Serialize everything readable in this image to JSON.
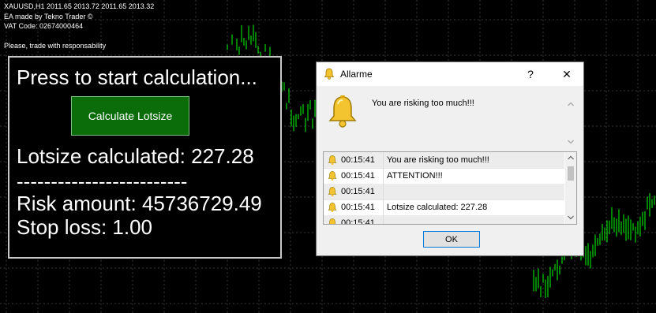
{
  "chart_info": {
    "line1": "XAUUSD,H1  2011.65 2013.72 2011.65 2013.32",
    "line2": "EA made by Tekno Trader ©",
    "line3": "VAT Code: 02674000464",
    "line4": "Please, trade with responsability"
  },
  "panel": {
    "heading": "Press to start calculation...",
    "button_label": "Calculate Lotsize",
    "lotsize_text": "Lotsize calculated: 227.28",
    "separator": "-------------------------",
    "risk_text": "Risk amount: 45736729.49",
    "stoploss_text": "Stop loss: 1.00"
  },
  "dialog": {
    "title": "Allarme",
    "help_glyph": "?",
    "close_glyph": "✕",
    "message": "You are risking too much!!!",
    "ok_label": "OK",
    "rows": [
      {
        "time": "00:15:41",
        "message": "You are risking too much!!!"
      },
      {
        "time": "00:15:41",
        "message": "ATTENTION!!!"
      },
      {
        "time": "00:15:41",
        "message": ""
      },
      {
        "time": "00:15:41",
        "message": "Lotsize calculated: 227.28"
      },
      {
        "time": "00:15:41",
        "message": ""
      }
    ]
  },
  "colors": {
    "chart_background": "#000000",
    "candle_color": "#00ff00",
    "button_green": "#0a6d0a",
    "bell_yellow": "#f4c430"
  },
  "icons": {
    "bell": "bell-icon",
    "up_arrow": "scroll-up-icon",
    "down_arrow": "scroll-down-icon"
  }
}
